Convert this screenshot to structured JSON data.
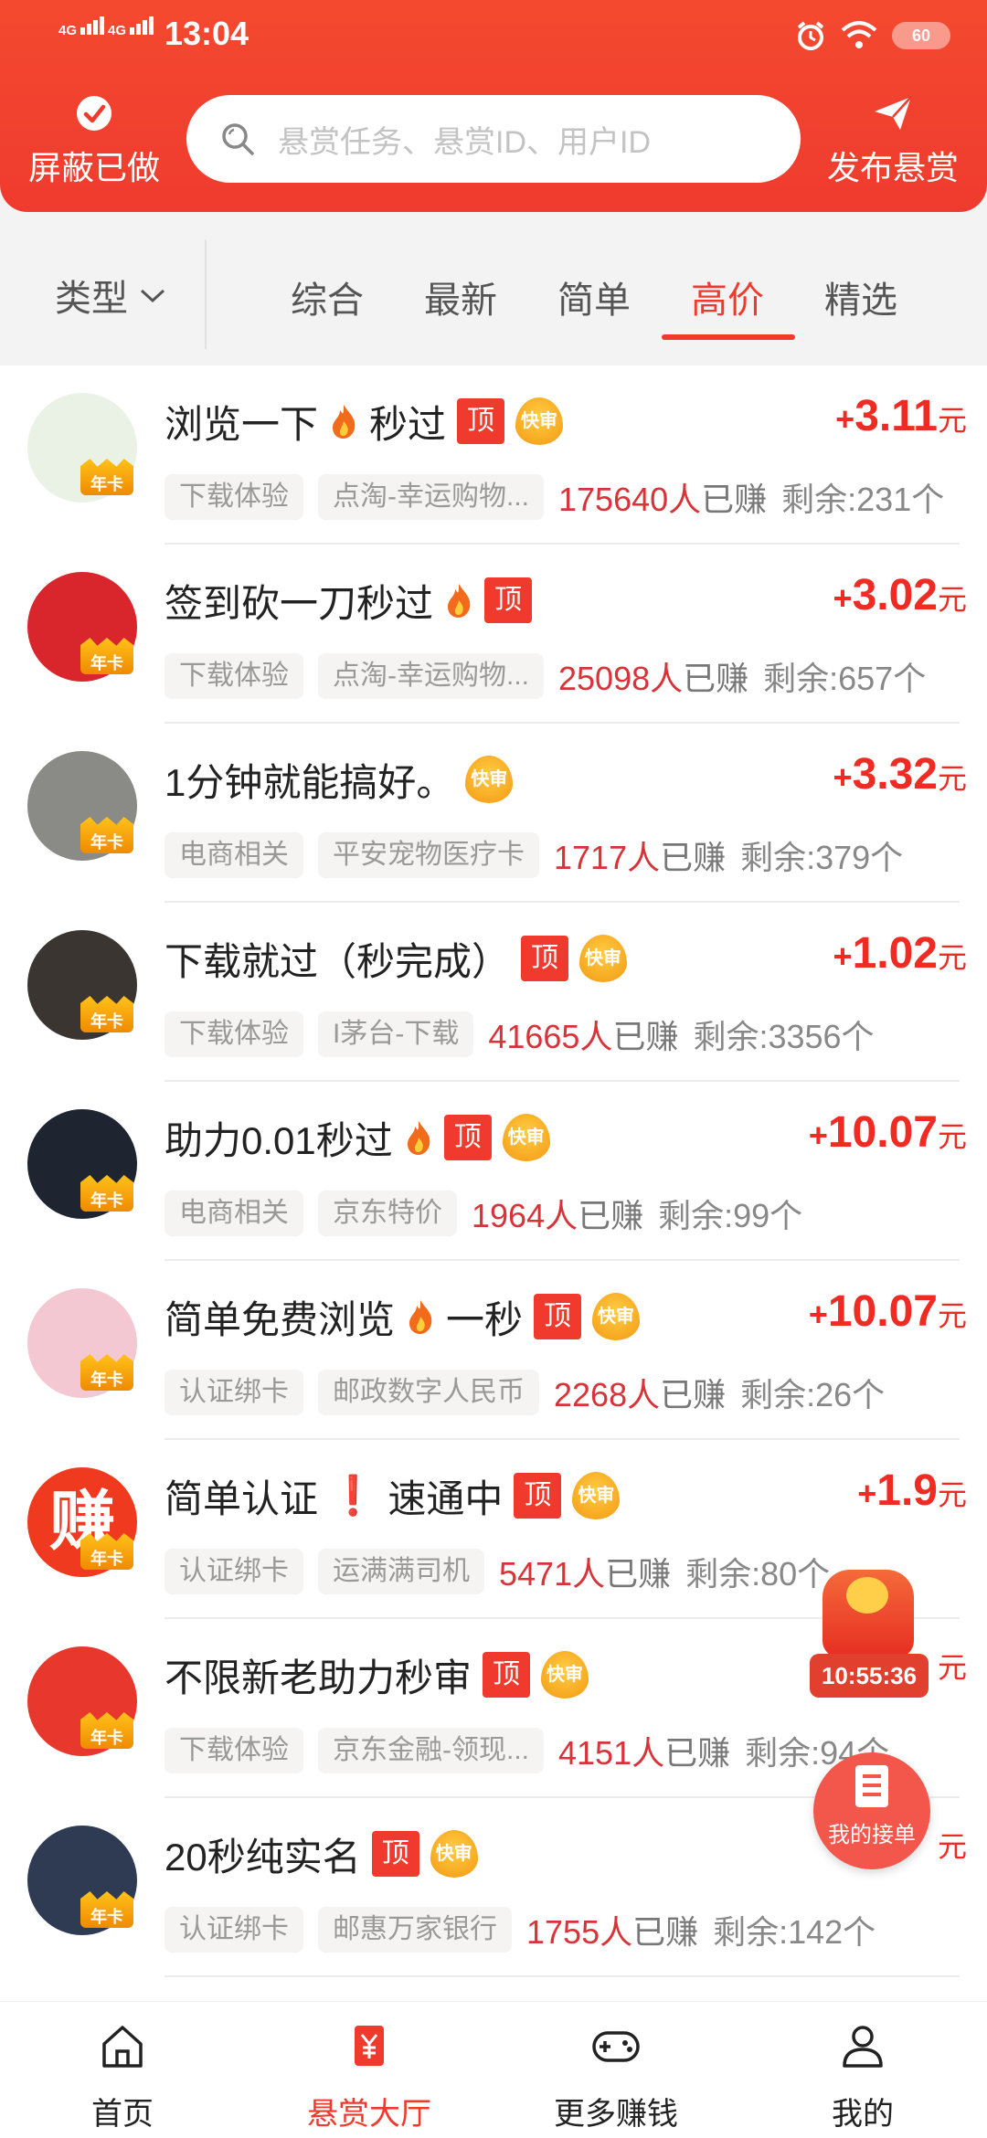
{
  "status_bar": {
    "network_1": "4G",
    "network_2": "4G",
    "time": "13:04",
    "battery": "60"
  },
  "header": {
    "hide_done_label": "屏蔽已做",
    "search_placeholder": "悬赏任务、悬赏ID、用户ID",
    "publish_label": "发布悬赏"
  },
  "filters": {
    "type_label": "类型",
    "tabs": [
      "综合",
      "最新",
      "简单",
      "高价",
      "精选"
    ],
    "active_tab": "高价"
  },
  "tasks": [
    {
      "title_a": "浏览一下",
      "flame": true,
      "title_b": "秒过",
      "top": "顶",
      "fast": "快审",
      "plus": "+",
      "price": "3.11",
      "unit": "元",
      "chip1": "下载体验",
      "chip2": "点淘-幸运购物...",
      "earned_count": "175640人",
      "earned_label": "已赚",
      "remain": "剩余:231个",
      "card": "年卡",
      "avatar_color": "#e9f2e4"
    },
    {
      "title_a": "签到砍一刀秒过",
      "flame": true,
      "title_b": "",
      "top": "顶",
      "fast": "",
      "plus": "+",
      "price": "3.02",
      "unit": "元",
      "chip1": "下载体验",
      "chip2": "点淘-幸运购物...",
      "earned_count": "25098人",
      "earned_label": "已赚",
      "remain": "剩余:657个",
      "card": "年卡",
      "avatar_color": "#d9252c"
    },
    {
      "title_a": "1分钟就能搞好。",
      "flame": false,
      "title_b": "",
      "top": "",
      "fast": "快审",
      "plus": "+",
      "price": "3.32",
      "unit": "元",
      "chip1": "电商相关",
      "chip2": "平安宠物医疗卡",
      "earned_count": "1717人",
      "earned_label": "已赚",
      "remain": "剩余:379个",
      "card": "年卡",
      "avatar_color": "#8a8a86"
    },
    {
      "title_a": "下载就过（秒完成）",
      "flame": false,
      "title_b": "",
      "top": "顶",
      "fast": "快审",
      "plus": "+",
      "price": "1.02",
      "unit": "元",
      "chip1": "下载体验",
      "chip2": "I茅台-下载",
      "earned_count": "41665人",
      "earned_label": "已赚",
      "remain": "剩余:3356个",
      "card": "年卡",
      "avatar_color": "#3a3530"
    },
    {
      "title_a": "助力0.01秒过",
      "flame": true,
      "title_b": "",
      "top": "顶",
      "fast": "快审",
      "plus": "+",
      "price": "10.07",
      "unit": "元",
      "chip1": "电商相关",
      "chip2": "京东特价",
      "earned_count": "1964人",
      "earned_label": "已赚",
      "remain": "剩余:99个",
      "card": "年卡",
      "avatar_color": "#1e2530"
    },
    {
      "title_a": "简单免费浏览",
      "flame": true,
      "title_b": "一秒",
      "top": "顶",
      "fast": "快审",
      "plus": "+",
      "price": "10.07",
      "unit": "元",
      "chip1": "认证绑卡",
      "chip2": "邮政数字人民币",
      "earned_count": "2268人",
      "earned_label": "已赚",
      "remain": "剩余:26个",
      "card": "年卡",
      "avatar_color": "#f4c8d2"
    },
    {
      "title_a": "简单认证",
      "flame": false,
      "exclaim": "❗",
      "title_b": "速通中",
      "top": "顶",
      "fast": "快审",
      "plus": "+",
      "price": "1.9",
      "unit": "元",
      "chip1": "认证绑卡",
      "chip2": "运满满司机",
      "earned_count": "5471人",
      "earned_label": "已赚",
      "remain": "剩余:80个",
      "card": "年卡",
      "avatar_color": "#ef3a1f",
      "avatar_text": "赚"
    },
    {
      "title_a": "不限新老助力秒审",
      "flame": false,
      "title_b": "",
      "top": "顶",
      "fast": "快审",
      "plus": "+",
      "price": "",
      "unit": "元",
      "chip1": "下载体验",
      "chip2": "京东金融-领现...",
      "earned_count": "4151人",
      "earned_label": "已赚",
      "remain": "剩余:94个",
      "card": "年卡",
      "avatar_color": "#e8382d"
    },
    {
      "title_a": "20秒纯实名",
      "flame": false,
      "title_b": "",
      "top": "顶",
      "fast": "快审",
      "plus": "",
      "price": "",
      "unit": "元",
      "chip1": "认证绑卡",
      "chip2": "邮惠万家银行",
      "earned_count": "1755人",
      "earned_label": "已赚",
      "remain": "剩余:142个",
      "card": "年卡",
      "avatar_color": "#2f3b52"
    }
  ],
  "floating": {
    "timer": "10:55:36",
    "my_orders": "我的接单"
  },
  "bottom_nav": {
    "items": [
      "首页",
      "悬赏大厅",
      "更多赚钱",
      "我的"
    ],
    "active": "悬赏大厅"
  },
  "colors": {
    "brand_red": "#ef3a2d",
    "price_red": "#ef2b23",
    "count_red": "#d9333a",
    "fast_badge": "#f39a12"
  }
}
